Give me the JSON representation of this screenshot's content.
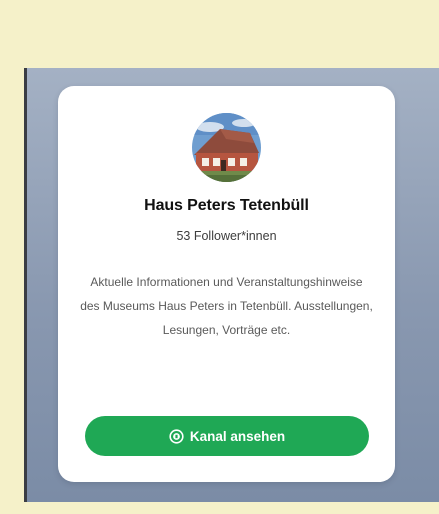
{
  "channel": {
    "name": "Haus Peters Tetenbüll",
    "followers": "53 Follower*innen",
    "description": "Aktuelle Informationen und Veranstaltungshinweise des Museums Haus Peters in Tetenbüll. Ausstellungen, Lesungen, Vorträge etc.",
    "avatar_icon": "channel-avatar-house-photo"
  },
  "action": {
    "view_label": "Kanal ansehen",
    "icon": "channel-icon"
  },
  "colors": {
    "accent": "#1fa855",
    "page_background": "#f5f1c9",
    "card_background": "#ffffff"
  }
}
